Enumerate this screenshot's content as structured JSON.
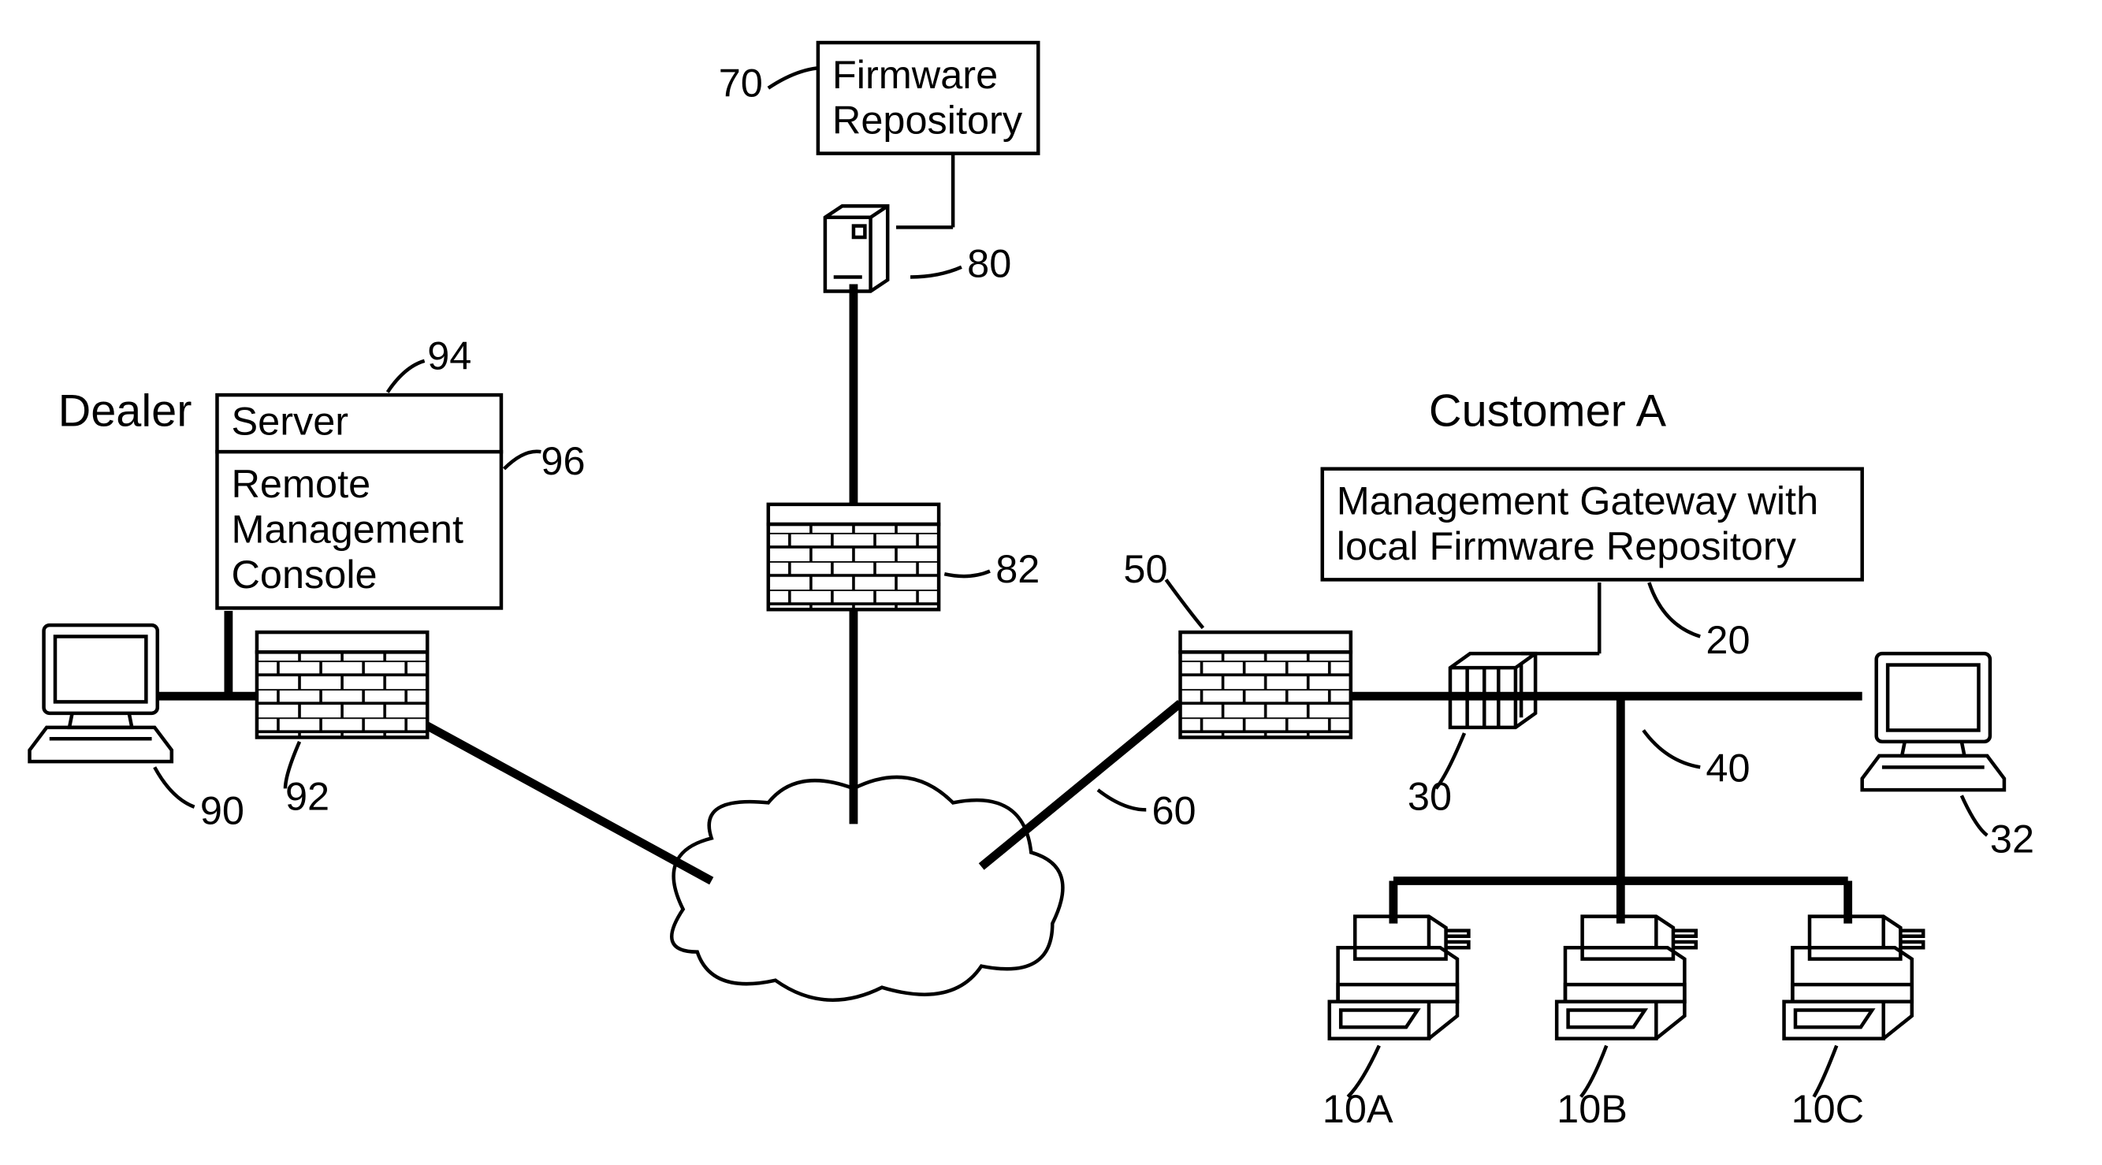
{
  "labels": {
    "dealer_heading": "Dealer",
    "customer_heading": "Customer A",
    "firmware_repo": "Firmware",
    "firmware_repo2": "Repository",
    "server": "Server",
    "rmc1": "Remote",
    "rmc2": "Management",
    "rmc3": "Console",
    "mgw1": "Management Gateway with",
    "mgw2": "local Firmware Repository",
    "ref70": "70",
    "ref80": "80",
    "ref82": "82",
    "ref94": "94",
    "ref96": "96",
    "ref90": "90",
    "ref92": "92",
    "ref50": "50",
    "ref60": "60",
    "ref20": "20",
    "ref30": "30",
    "ref40": "40",
    "ref32": "32",
    "ref10a": "10A",
    "ref10b": "10B",
    "ref10c": "10C"
  }
}
